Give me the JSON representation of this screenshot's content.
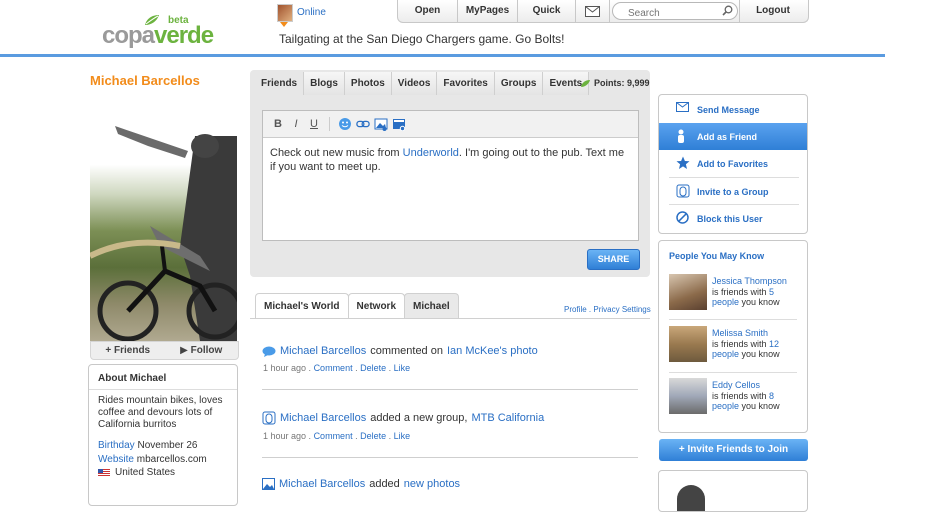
{
  "brand": {
    "logo_main": "copa",
    "logo_accent": "verde",
    "badge": "beta",
    "accent": "#6cb33f",
    "name_color": "#f28c1b",
    "link_color": "#2a6fc4"
  },
  "header": {
    "online_label": "Online",
    "status_message": "Tailgating at the San Diego Chargers game. Go Bolts!",
    "nav": {
      "open": "Open",
      "mypages": "MyPages",
      "quick": "Quick",
      "logout": "Logout"
    },
    "search_placeholder": "Search"
  },
  "profile": {
    "name": "Michael Barcellos",
    "friends_action": "+ Friends",
    "follow_action": "Follow",
    "about": {
      "title": "About Michael",
      "bio": "Rides mountain bikes, loves coffee and devours lots of California  burritos",
      "birthday_label": "Birthday",
      "birthday_value": "November 26",
      "website_label": "Website",
      "website_value": "mbarcellos.com",
      "country": "United States"
    }
  },
  "composer": {
    "tabs": [
      "Friends",
      "Blogs",
      "Photos",
      "Videos",
      "Favorites",
      "Groups",
      "Events"
    ],
    "points": "Points: 9,999",
    "toolbar": {
      "bold": "B",
      "italic": "I",
      "underline": "U"
    },
    "text_before": "Check out new music from ",
    "text_link": "Underworld",
    "text_after": ". I'm going out to the pub. Text me if you want to meet up.",
    "share_label": "SHARE"
  },
  "feed": {
    "tabs": [
      "Michael's World",
      "Network",
      "Michael"
    ],
    "profile_link": "Profile",
    "dot": ".",
    "privacy_link": "Privacy Settings",
    "items": [
      {
        "actor": "Michael Barcellos",
        "verb": "commented on",
        "object": "Ian McKee's photo",
        "time": "1 hour ago",
        "actions": [
          "Comment",
          "Delete",
          "Like"
        ]
      },
      {
        "actor": "Michael Barcellos",
        "verb": "added a new group,",
        "object": "MTB California",
        "time": "1 hour ago",
        "actions": [
          "Comment",
          "Delete",
          "Like"
        ]
      },
      {
        "actor": "Michael Barcellos",
        "verb": "added",
        "object": "new photos"
      }
    ]
  },
  "actions": [
    "Send Message",
    "Add as Friend",
    "Add to Favorites",
    "Invite to a Group",
    "Block this User"
  ],
  "people": {
    "title": "People You May Know",
    "list": [
      {
        "name": "Jessica Thompson",
        "prefix": "is friends with",
        "count": "5",
        "suffix_link": "people",
        "suffix": "you know"
      },
      {
        "name": "Melissa Smith",
        "prefix": "is friends with",
        "count": "12",
        "suffix_link": "people",
        "suffix": "you know"
      },
      {
        "name": "Eddy Cellos",
        "prefix": "is friends with",
        "count": "8",
        "suffix_link": "people",
        "suffix": "you know"
      }
    ]
  },
  "invite_label": "+ Invite Friends to Join"
}
